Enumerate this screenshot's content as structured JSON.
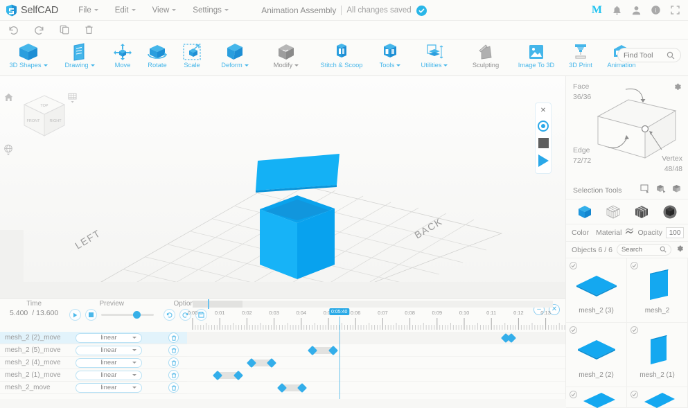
{
  "header": {
    "logo_text": "SelfCAD",
    "menus": [
      {
        "label": "File",
        "caret": true
      },
      {
        "label": "Edit",
        "caret": true
      },
      {
        "label": "View",
        "caret": true
      },
      {
        "label": "Settings",
        "caret": true
      }
    ],
    "project_name": "Animation Assembly",
    "save_status": "All changes saved",
    "right_icons": [
      {
        "name": "mymini-logo",
        "glyph": "M"
      },
      {
        "name": "notifications-bell-icon"
      },
      {
        "name": "user-account-icon"
      },
      {
        "name": "help-info-icon"
      },
      {
        "name": "fullscreen-icon"
      }
    ]
  },
  "subbar": {
    "items": [
      {
        "name": "undo-icon"
      },
      {
        "name": "redo-icon"
      },
      {
        "name": "copy-icon"
      },
      {
        "name": "delete-trash-icon"
      }
    ]
  },
  "toolbar": {
    "tools": [
      {
        "label": "3D Shapes",
        "caret": true,
        "icon": "cube-blue-icon",
        "gray": false
      },
      {
        "label": "Drawing",
        "caret": true,
        "icon": "drawing-icon",
        "gray": false
      },
      {
        "label": "Move",
        "caret": false,
        "icon": "move-icon",
        "gray": false
      },
      {
        "label": "Rotate",
        "caret": false,
        "icon": "rotate-icon",
        "gray": false
      },
      {
        "label": "Scale",
        "caret": false,
        "icon": "scale-icon",
        "gray": false
      },
      {
        "label": "Deform",
        "caret": true,
        "icon": "deform-icon",
        "gray": false
      },
      {
        "label": "Modify",
        "caret": true,
        "icon": "modify-icon",
        "gray": true
      },
      {
        "label": "Stitch & Scoop",
        "caret": false,
        "icon": "stitch-scoop-icon",
        "gray": false
      },
      {
        "label": "Tools",
        "caret": true,
        "icon": "tools-icon",
        "gray": false
      },
      {
        "label": "Utilities",
        "caret": true,
        "icon": "utilities-icon",
        "gray": false
      },
      {
        "label": "Sculpting",
        "caret": false,
        "icon": "sculpting-icon",
        "gray": true
      },
      {
        "label": "Image To 3D",
        "caret": false,
        "icon": "image-to-3d-icon",
        "gray": false
      },
      {
        "label": "3D Print",
        "caret": false,
        "icon": "3d-print-icon",
        "gray": false
      },
      {
        "label": "Animation",
        "caret": false,
        "icon": "animation-icon",
        "gray": false
      }
    ],
    "find_tool_placeholder": "Find Tool"
  },
  "viewport": {
    "orientation_labels": [
      {
        "text": "LEFT",
        "name": "viewport-label-left"
      },
      {
        "text": "BACK",
        "name": "viewport-label-back"
      }
    ],
    "navcube_faces": [
      "TOP",
      "FRONT",
      "RIGHT"
    ],
    "controls": [
      {
        "name": "recording-close-button",
        "label": "✕"
      },
      {
        "name": "record-button"
      },
      {
        "name": "stop-button"
      },
      {
        "name": "play-button"
      }
    ]
  },
  "right_panel": {
    "selection": {
      "face_label": "Face",
      "face_value": "36/36",
      "edge_label": "Edge",
      "edge_value": "72/72",
      "vertex_label": "Vertex",
      "vertex_value": "48/48",
      "tools_label": "Selection Tools"
    },
    "properties": {
      "color_label": "Color",
      "color_value": "#1c1c1c",
      "material_label": "Material",
      "opacity_label": "Opacity",
      "opacity_value": "100"
    },
    "objects": {
      "count_label": "Objects 6 / 6",
      "search_placeholder": "Search",
      "items": [
        {
          "name": "mesh_2 (3)",
          "shape": "flat",
          "checked": true
        },
        {
          "name": "mesh_2",
          "shape": "vertical",
          "checked": true
        },
        {
          "name": "mesh_2 (2)",
          "shape": "flat",
          "checked": true
        },
        {
          "name": "mesh_2 (1)",
          "shape": "vertical",
          "checked": true
        },
        {
          "name": "",
          "shape": "partial",
          "checked": true
        },
        {
          "name": "",
          "shape": "partial",
          "checked": true
        }
      ]
    }
  },
  "timeline": {
    "time_label": "Time",
    "time_current": "5.400",
    "time_total": "/ 13.600",
    "preview_label": "Preview",
    "options_label": "Options",
    "playhead_badge": "0:05:40",
    "ruler_ticks": [
      "0:00",
      "0:01",
      "0:02",
      "0:03",
      "0:04",
      "0:05",
      "0:06",
      "0:07",
      "0:08",
      "0:09",
      "0:10",
      "0:11",
      "0:12",
      "0:13"
    ],
    "window_buttons": [
      {
        "name": "minimize-timeline-button",
        "label": "–"
      },
      {
        "name": "close-timeline-button",
        "label": "✕"
      }
    ],
    "tracks": [
      {
        "name": "mesh_2 (2)_move",
        "easing": "linear",
        "selected": true,
        "keys": [
          [
            460,
            468
          ]
        ]
      },
      {
        "name": "mesh_2 (5)_move",
        "easing": "linear",
        "selected": false,
        "keys": [
          [
            181,
            211
          ]
        ]
      },
      {
        "name": "mesh_2 (4)_move",
        "easing": "linear",
        "selected": false,
        "keys": [
          [
            93,
            122
          ]
        ]
      },
      {
        "name": "mesh_2 (1)_move",
        "easing": "linear",
        "selected": false,
        "keys": [
          [
            44,
            74
          ]
        ]
      },
      {
        "name": "mesh_2_move",
        "easing": "linear",
        "selected": false,
        "keys": [
          [
            137,
            166
          ]
        ]
      }
    ]
  }
}
